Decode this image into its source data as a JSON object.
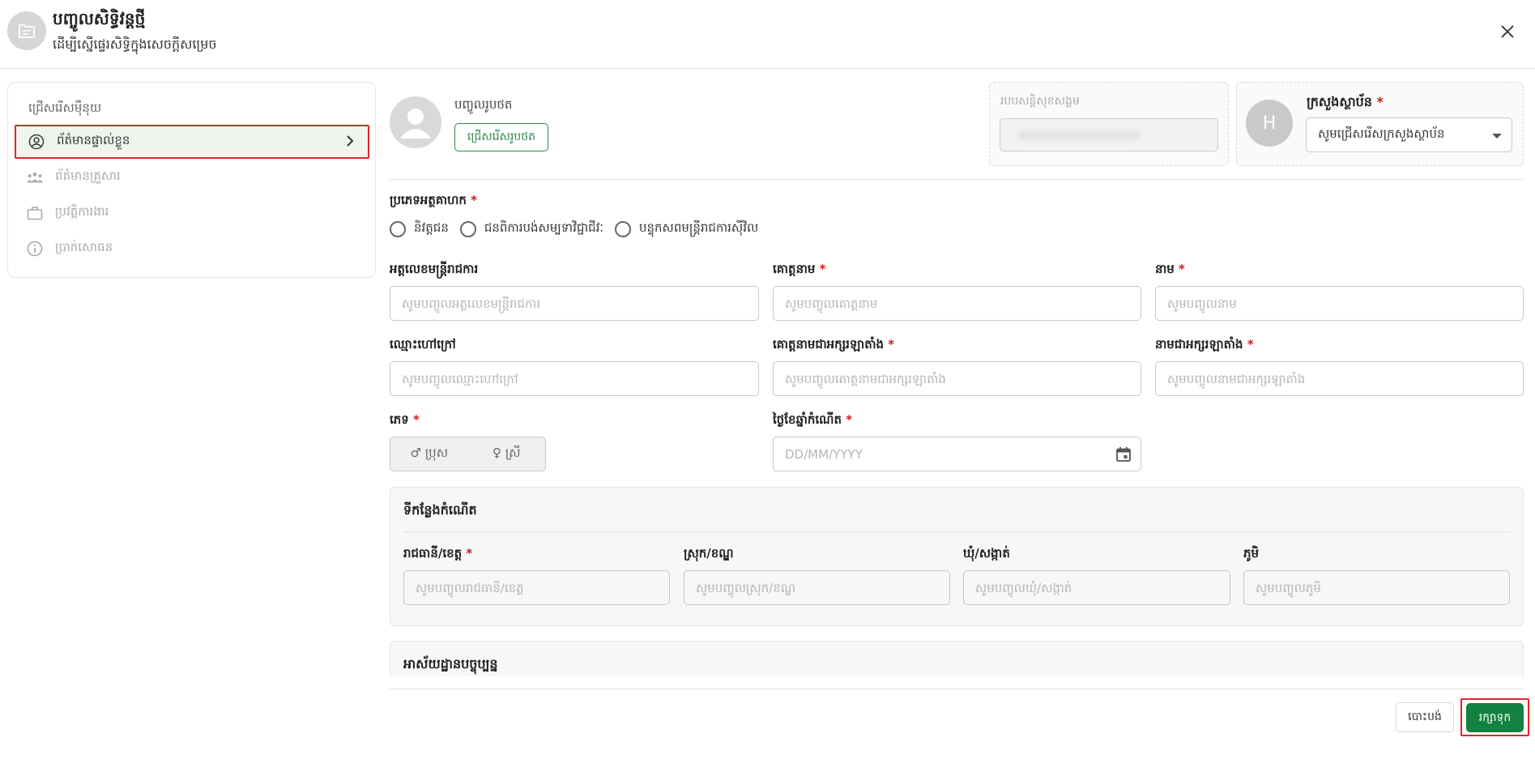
{
  "header": {
    "title": "បញ្ចូលសិទ្ធិវន្តថ្មី",
    "subtitle": "ដើម្បីស្នើផ្ទេរសិទ្ធិក្នុងសេចក្តីសម្រេច"
  },
  "sidebar": {
    "title": "ជ្រើសរើសម៉ឺនុយ",
    "items": [
      {
        "label": "ព័ត៌មានផ្ទាល់ខ្លួន",
        "icon": "user-circle-icon",
        "active": true
      },
      {
        "label": "ព័ត៌មានគ្រួសារ",
        "icon": "family-icon",
        "active": false
      },
      {
        "label": "ប្រវត្តិការងារ",
        "icon": "briefcase-icon",
        "active": false
      },
      {
        "label": "ប្រាក់សោធន",
        "icon": "info-icon",
        "active": false
      }
    ]
  },
  "photo": {
    "label": "បញ្ចូលរូបថត",
    "button": "ជ្រើសរើសរូបថត"
  },
  "nssf": {
    "label": "របបសន្តិសុខសង្គម"
  },
  "ministry": {
    "avatar_letter": "H",
    "label": "ក្រសួងស្ថាប័ន",
    "required": "*",
    "select_value": "សូមជ្រើសរើសក្រសួងស្ថាប័ន"
  },
  "beneficiary_type": {
    "label": "ប្រភេទអត្ថគាហក",
    "required": "*",
    "options": [
      "និវត្តជន",
      "ជនពិការបង់សម្បទាវិជ្ជាជីវៈ",
      "បន្ទុកសពមន្ត្រីរាជការស៊ីវិល"
    ]
  },
  "fields": {
    "civil_id": {
      "label": "អត្តលេខមន្ត្រីរាជការ",
      "placeholder": "សូមបញ្ចូលអត្តលេខមន្ត្រីរាជការ"
    },
    "surname": {
      "label": "គោត្តនាម",
      "required": "*",
      "placeholder": "សូមបញ្ចូលគោត្តនាម"
    },
    "name": {
      "label": "នាម",
      "required": "*",
      "placeholder": "សូមបញ្ចូលនាម"
    },
    "nickname": {
      "label": "ឈ្មោះហៅក្រៅ",
      "placeholder": "សូមបញ្ចូលឈ្មោះហៅក្រៅ"
    },
    "surname_latin": {
      "label": "គោត្តនាមជាអក្សរឡាតាំង",
      "required": "*",
      "placeholder": "សូមបញ្ចូលគោត្តនាមជាអក្សរឡាតាំង"
    },
    "name_latin": {
      "label": "នាមជាអក្សរឡាតាំង",
      "required": "*",
      "placeholder": "សូមបញ្ចូលនាមជាអក្សរឡាតាំង"
    },
    "gender": {
      "label": "ភេទ",
      "required": "*",
      "male": "♂ ប្រុស",
      "female": "♀ ស្រី"
    },
    "dob": {
      "label": "ថ្ងៃខែឆ្នាំកំណើត",
      "required": "*",
      "placeholder": "DD/MM/YYYY"
    }
  },
  "birthplace": {
    "title": "ទីកន្លែងកំណើត",
    "province": {
      "label": "រាជធានី/ខេត្ត",
      "required": "*",
      "placeholder": "សូមបញ្ចូលរាជធានី/ខេត្ត"
    },
    "district": {
      "label": "ស្រុក/ខណ្ឌ",
      "placeholder": "សូមបញ្ចូលស្រុក/ខណ្ឌ"
    },
    "commune": {
      "label": "ឃុំ/សង្កាត់",
      "placeholder": "សូមបញ្ចូលឃុំ/សង្កាត់"
    },
    "village": {
      "label": "ភូមិ",
      "placeholder": "សូមបញ្ចូលភូមិ"
    }
  },
  "current_address": {
    "title": "អាស័យដ្ឋានបច្ចុប្បន្ន"
  },
  "footer": {
    "cancel": "បោះបង់",
    "save": "រក្សាទុក"
  },
  "colors": {
    "primary": "#13813f",
    "required": "#d11a1a",
    "highlight": "#e0262b"
  }
}
